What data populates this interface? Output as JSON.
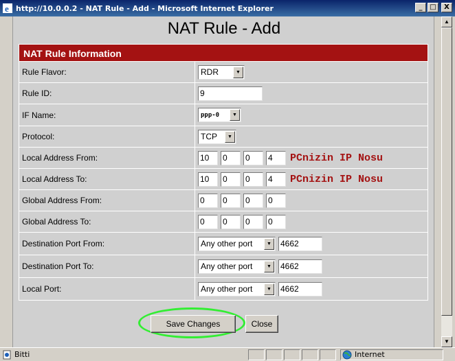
{
  "window": {
    "title": "http://10.0.0.2 - NAT Rule - Add - Microsoft Internet Explorer",
    "minimize": "_",
    "maximize": "□",
    "close": "X"
  },
  "page": {
    "title": "NAT Rule - Add",
    "section_header": "NAT Rule Information"
  },
  "form": {
    "rule_flavor": {
      "label": "Rule Flavor:",
      "value": "RDR"
    },
    "rule_id": {
      "label": "Rule ID:",
      "value": "9"
    },
    "if_name": {
      "label": "IF Name:",
      "value": "ppp-0"
    },
    "protocol": {
      "label": "Protocol:",
      "value": "TCP"
    },
    "local_from": {
      "label": "Local Address From:",
      "octets": [
        "10",
        "0",
        "0",
        "4"
      ],
      "hint": "PCnizin IP Nosu"
    },
    "local_to": {
      "label": "Local Address To:",
      "octets": [
        "10",
        "0",
        "0",
        "4"
      ],
      "hint": "PCnizin IP Nosu"
    },
    "global_from": {
      "label": "Global Address From:",
      "octets": [
        "0",
        "0",
        "0",
        "0"
      ]
    },
    "global_to": {
      "label": "Global Address To:",
      "octets": [
        "0",
        "0",
        "0",
        "0"
      ]
    },
    "dest_port_from": {
      "label": "Destination Port From:",
      "select": "Any other port",
      "port": "4662"
    },
    "dest_port_to": {
      "label": "Destination Port To:",
      "select": "Any other port",
      "port": "4662"
    },
    "local_port": {
      "label": "Local Port:",
      "select": "Any other port",
      "port": "4662"
    }
  },
  "buttons": {
    "save": "Save Changes",
    "close": "Close"
  },
  "statusbar": {
    "text": "Bitti",
    "zone": "Internet"
  },
  "colors": {
    "header_bg": "#a41212",
    "highlight": "#33ee33",
    "titlebar": "#0a246a"
  }
}
